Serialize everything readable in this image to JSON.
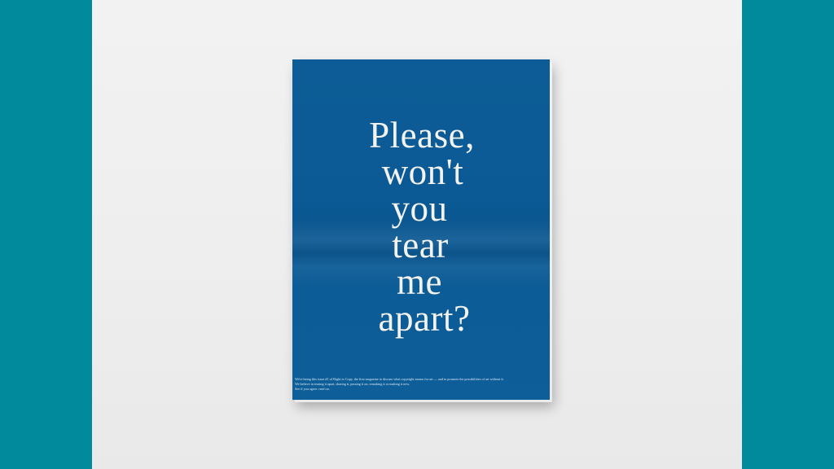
{
  "poster": {
    "headline_lines": [
      "Please,",
      "won't",
      "you",
      "tear",
      "me",
      "apart?"
    ],
    "footnote_lines": [
      "We're being this issue #1 of Right to Copy, the first magazine to discuss what copyright means for art — and to promote the possibilities of art without it.",
      "We believe in tearing it apart, sharing it, passing it on, remaking it or making it new.",
      "See if you agree: read on."
    ]
  },
  "colors": {
    "frame": "#008a9b",
    "wall": "#eeeeee",
    "poster": "#0b5a95",
    "text": "#f2f2ee"
  }
}
